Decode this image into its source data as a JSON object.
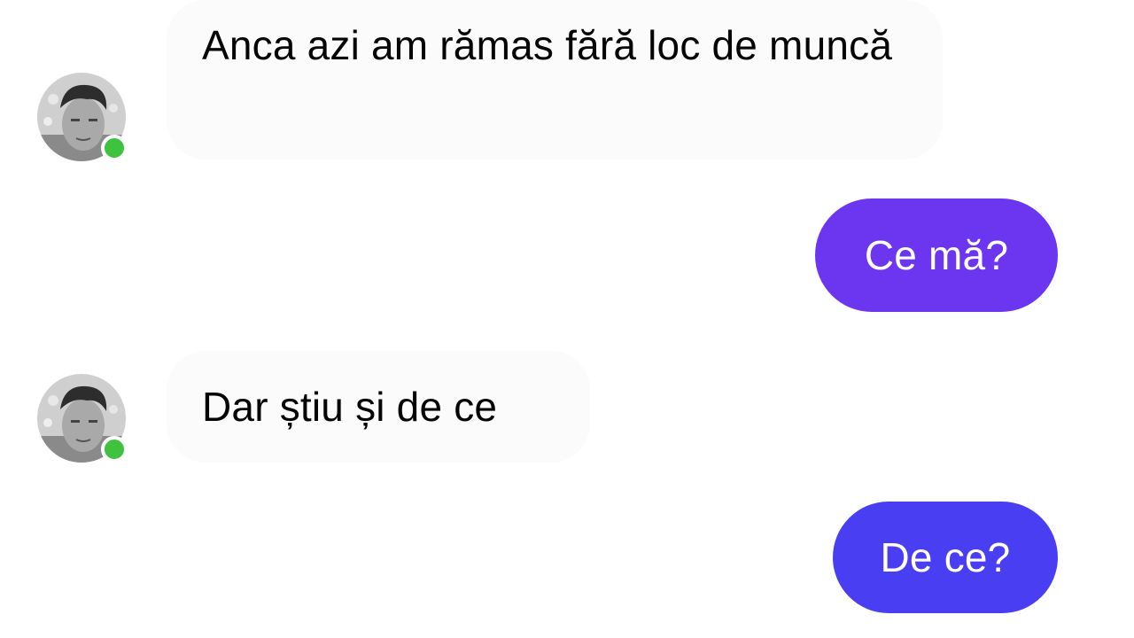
{
  "conversation": {
    "messages": [
      {
        "from": "contact",
        "text": "Anca azi am rămas fără loc de muncă"
      },
      {
        "from": "me",
        "text": "Ce mă?"
      },
      {
        "from": "contact",
        "text": "Dar știu și de ce"
      },
      {
        "from": "me",
        "text": "De ce?"
      }
    ]
  },
  "colors": {
    "received_bubble": "#fbfbfb",
    "sent_bubble_1": "#6c35f0",
    "sent_bubble_2": "#4a3ef2",
    "online_indicator": "#3fc33f"
  },
  "icons": {
    "avatar": "contact-avatar-photo",
    "presence": "online-status-dot"
  }
}
